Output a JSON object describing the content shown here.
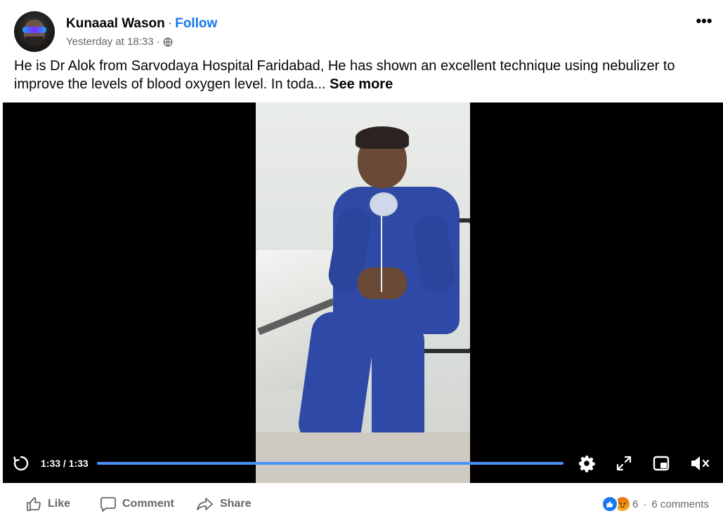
{
  "post": {
    "author": "Kunaaal Wason",
    "separator": "·",
    "follow_label": "Follow",
    "timestamp": "Yesterday at 18:33 ·",
    "audience_icon": "globe-icon",
    "more_icon": "more-options-icon",
    "more_label": "•••",
    "text": "He is Dr Alok from Sarvodaya Hospital Faridabad, He has shown an excellent technique using nebulizer to improve the levels of blood oxygen level. In toda...",
    "see_more_label": "See more"
  },
  "video": {
    "time_display": "1:33 / 1:33",
    "progress": 1.0,
    "accent_color": "#4a90ff"
  },
  "actions": {
    "like_label": "Like",
    "comment_label": "Comment",
    "share_label": "Share"
  },
  "engagement": {
    "reaction_count": "6",
    "separator": "·",
    "comments_label": "6 comments"
  },
  "colors": {
    "brand_blue": "#1877f2",
    "secondary_text": "#65676b",
    "primary_text": "#050505"
  }
}
